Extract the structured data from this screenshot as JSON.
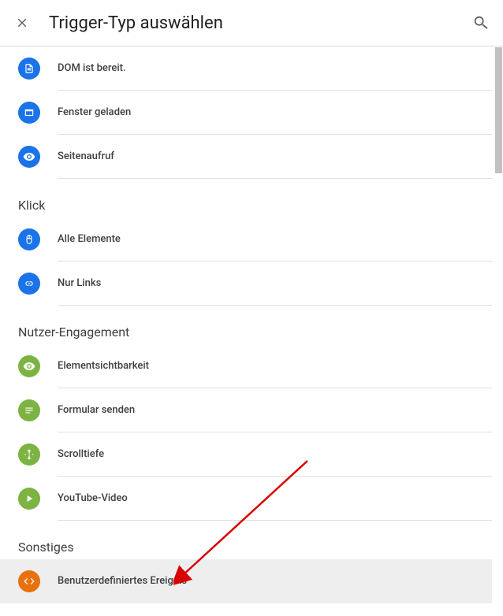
{
  "header": {
    "title": "Trigger-Typ auswählen"
  },
  "sections": {
    "pageview": {
      "items": [
        {
          "label": "DOM ist bereit."
        },
        {
          "label": "Fenster geladen"
        },
        {
          "label": "Seitenaufruf"
        }
      ]
    },
    "click": {
      "title": "Klick",
      "items": [
        {
          "label": "Alle Elemente"
        },
        {
          "label": "Nur Links"
        }
      ]
    },
    "engagement": {
      "title": "Nutzer-Engagement",
      "items": [
        {
          "label": "Elementsichtbarkeit"
        },
        {
          "label": "Formular senden"
        },
        {
          "label": "Scrolltiefe"
        },
        {
          "label": "YouTube-Video"
        }
      ]
    },
    "other": {
      "title": "Sonstiges",
      "items": [
        {
          "label": "Benutzerdefiniertes Ereignis"
        }
      ]
    }
  }
}
